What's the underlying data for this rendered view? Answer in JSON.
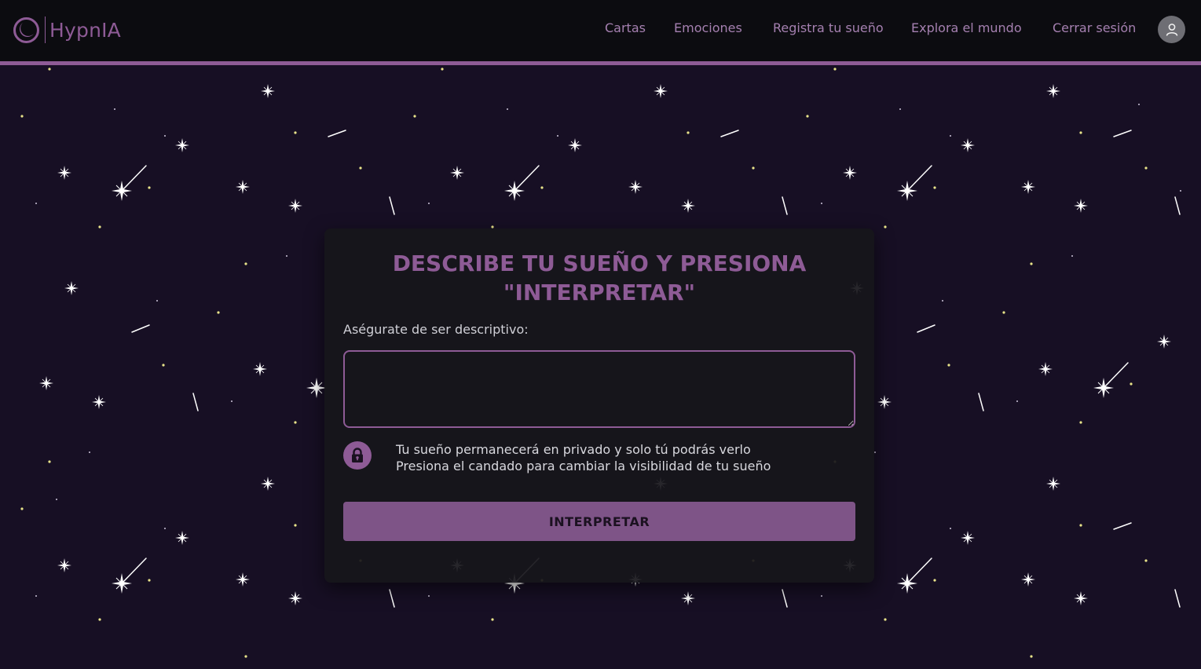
{
  "app": {
    "brand": "HypnIA",
    "logo_icon": "crescent-moon-icon"
  },
  "nav": {
    "items": [
      {
        "label": "Cartas"
      },
      {
        "label": "Emociones"
      },
      {
        "label": "Registra tu sueño"
      },
      {
        "label": "Explora el mundo"
      },
      {
        "label": "Cerrar sesión"
      }
    ],
    "avatar_icon": "user-icon"
  },
  "form": {
    "title": "DESCRIBE TU SUEÑO Y PRESIONA \"INTERPRETAR\"",
    "field_label": "Aségurate de ser descriptivo:",
    "dream_value": "",
    "privacy_line_1": "Tu sueño permanecerá en privado y solo tú podrás verlo",
    "privacy_line_2": "Presiona el candado para cambiar la visibilidad de tu sueño",
    "lock_icon": "padlock-icon",
    "submit_label": "INTERPRETAR"
  },
  "colors": {
    "accent": "#8e5b96",
    "navbar_bg": "#0c0c10",
    "page_bg": "#170f24",
    "card_bg": "#17151b",
    "button_bg": "#7e5487"
  }
}
